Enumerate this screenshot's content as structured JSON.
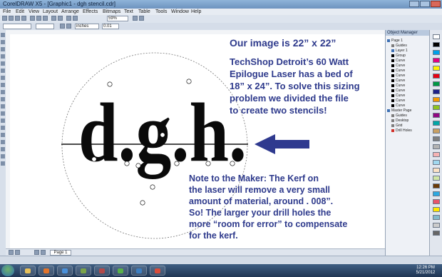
{
  "window": {
    "title": "CorelDRAW X5 - [Graphic1 - dgh stencil.cdr]"
  },
  "menu": [
    "File",
    "Edit",
    "View",
    "Layout",
    "Arrange",
    "Effects",
    "Bitmaps",
    "Text",
    "Table",
    "Tools",
    "Window",
    "Help"
  ],
  "toolbar": {
    "zoom": "59%",
    "units": "inches",
    "nudge": "0.01"
  },
  "page_tab": "Page 1",
  "artwork": {
    "letters": "d.g.h."
  },
  "annotations": {
    "size_note": "Our image is 22” x 22”",
    "bed_note_lines": [
      "TechShop Detroit’s 60 Watt",
      "Epilogue Laser has a bed of",
      "18” x 24”. To solve this sizing",
      "problem we divided the file",
      "to create two stencils!"
    ],
    "kerf_note_lines": [
      "Note to the Maker: The Kerf on",
      "the laser will remove a very small",
      "amount of material, around . 008”.",
      "So! The larger your drill holes the",
      "more “room for error” to compensate",
      "for the kerf."
    ],
    "arrow_color": "#2f3a8f",
    "text_color": "#2e3a8c"
  },
  "docker": {
    "title": "Object Manager",
    "rows": [
      "Page 1",
      "Guides",
      "Layer 1",
      "Group",
      "Curve",
      "Curve",
      "Curve",
      "Curve",
      "Curve",
      "Curve",
      "Curve",
      "Curve",
      "Curve",
      "Curve",
      "Master Page",
      "Guides",
      "Desktop",
      "Grid",
      "Drill Holes"
    ]
  },
  "palette": [
    "#ffffff",
    "#000000",
    "#00a0e9",
    "#e4007f",
    "#fff100",
    "#e60012",
    "#009944",
    "#1d2088",
    "#f39800",
    "#8fc31f",
    "#920783",
    "#00a6a6",
    "#c9a063",
    "#7f7f7f",
    "#b3b3b3",
    "#f5b2b2",
    "#a0d8ef",
    "#fce2c4",
    "#d0e6a5",
    "#6a3906",
    "#2ca9e1",
    "#e9546b",
    "#ffe600",
    "#84b9cb",
    "#cccccc",
    "#666666"
  ],
  "taskbar": {
    "time": "12:26 PM",
    "date": "5/21/2012"
  }
}
